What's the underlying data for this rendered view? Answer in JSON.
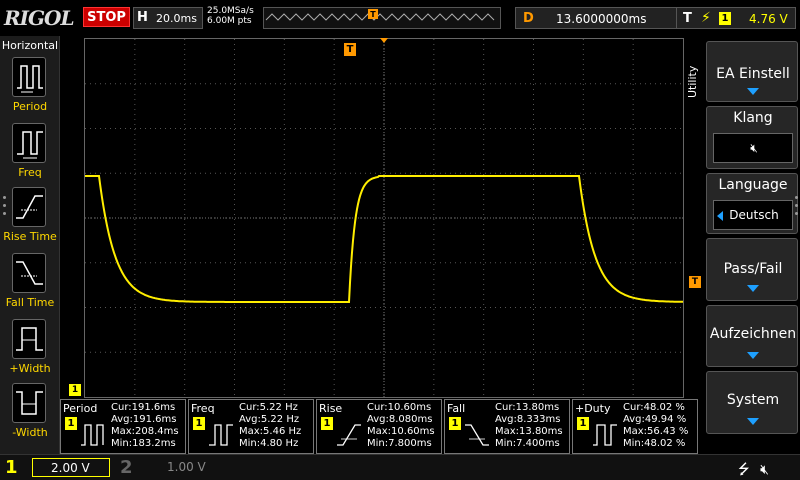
{
  "topbar": {
    "logo": "RIGOL",
    "run_state": "STOP",
    "h_label": "H",
    "timebase": "20.0ms",
    "sample_rate": "25.0MSa/s",
    "mem_depth": "6.00M pts",
    "delay_label": "D",
    "delay_value": "13.6000000ms",
    "trigger_label": "T",
    "trigger_channel": "1",
    "trigger_level": "4.76 V"
  },
  "left_panel": {
    "title": "Horizontal",
    "items": [
      {
        "label": "Period"
      },
      {
        "label": "Freq"
      },
      {
        "label": "Rise Time"
      },
      {
        "label": "Fall Time"
      },
      {
        "label": "+Width"
      },
      {
        "label": "-Width"
      }
    ]
  },
  "screen": {
    "trace_color": "#ffee00",
    "trigger_marker": "T",
    "channel_marker": "1"
  },
  "measurements": [
    {
      "name": "Period",
      "channel": "1",
      "cur": "Cur:191.6ms",
      "avg": "Avg:191.6ms",
      "max": "Max:208.4ms",
      "min": "Min:183.2ms"
    },
    {
      "name": "Freq",
      "channel": "1",
      "cur": "Cur:5.22 Hz",
      "avg": "Avg:5.22 Hz",
      "max": "Max:5.46 Hz",
      "min": "Min:4.80 Hz"
    },
    {
      "name": "Rise",
      "channel": "1",
      "cur": "Cur:10.60ms",
      "avg": "Avg:8.080ms",
      "max": "Max:10.60ms",
      "min": "Min:7.800ms"
    },
    {
      "name": "Fall",
      "channel": "1",
      "cur": "Cur:13.80ms",
      "avg": "Avg:8.333ms",
      "max": "Max:13.80ms",
      "min": "Min:7.400ms"
    },
    {
      "name": "+Duty",
      "channel": "1",
      "cur": "Cur:48.02 %",
      "avg": "Avg:49.94 %",
      "max": "Max:56.43 %",
      "min": "Min:48.02 %"
    }
  ],
  "right_menu": {
    "side_label": "Utility",
    "buttons": [
      {
        "label": "EA Einstell"
      },
      {
        "label": "Klang"
      },
      {
        "label": "Language",
        "value": "Deutsch"
      },
      {
        "label": "Pass/Fail"
      },
      {
        "label": "Aufzeichnen"
      },
      {
        "label": "System"
      }
    ]
  },
  "bottombar": {
    "ch1_num": "1",
    "ch1_scale": "2.00 V",
    "ch2_num": "2",
    "ch2_scale": "1.00 V"
  }
}
